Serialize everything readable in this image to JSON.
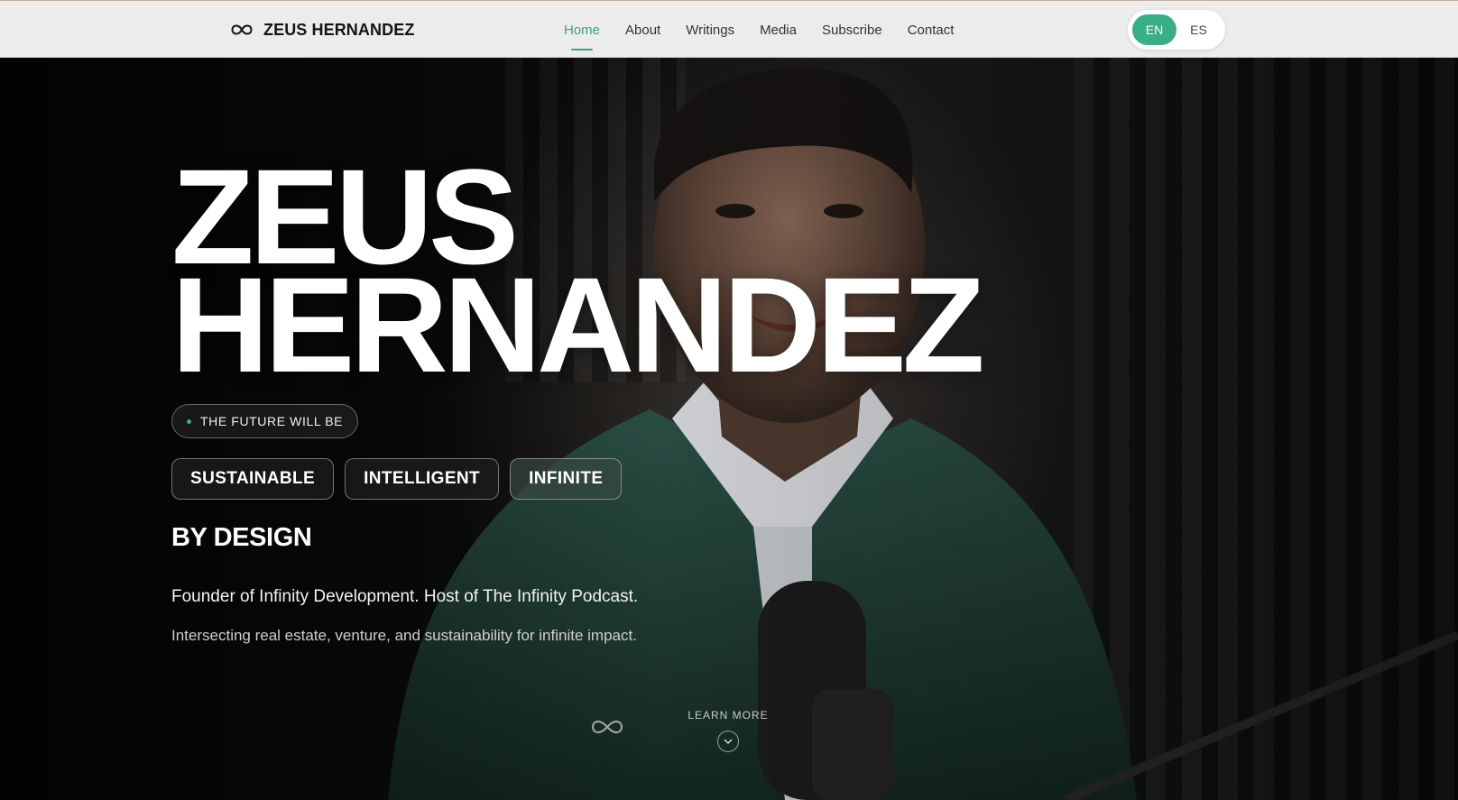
{
  "header": {
    "brand_name": "ZEUS HERNANDEZ",
    "brand_icon": "infinity-icon",
    "nav": [
      {
        "label": "Home",
        "active": true
      },
      {
        "label": "About",
        "active": false
      },
      {
        "label": "Writings",
        "active": false
      },
      {
        "label": "Media",
        "active": false
      },
      {
        "label": "Subscribe",
        "active": false
      },
      {
        "label": "Contact",
        "active": false
      }
    ],
    "languages": [
      {
        "label": "EN",
        "active": true
      },
      {
        "label": "ES",
        "active": false
      }
    ]
  },
  "hero": {
    "name_line1": "ZEUS",
    "name_line2": "HERNANDEZ",
    "tagline": "THE FUTURE WILL BE",
    "chips": [
      "SUSTAINABLE",
      "INTELLIGENT",
      "INFINITE"
    ],
    "by_design": "BY DESIGN",
    "lead": "Founder of Infinity Development. Host of The Infinity Podcast.",
    "sub": "Intersecting real estate, venture, and sustainability for infinite impact.",
    "learn_more": "LEARN MORE",
    "learn_more_icon": "chevron-down-icon",
    "background_image": "portrait of a man in a green blazer speaking into a studio microphone"
  },
  "colors": {
    "accent": "#3aae84",
    "nav_active": "#3aa37f",
    "header_bg": "#ececec",
    "hero_text": "#ffffff"
  }
}
